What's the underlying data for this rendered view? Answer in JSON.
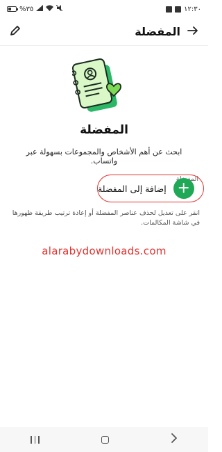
{
  "status_bar": {
    "time": "١٢:٣٠",
    "battery_text": "%٣٥",
    "battery_level": 0.35
  },
  "header": {
    "title": "المفضلة",
    "back_icon": "arrow-right-icon",
    "edit_icon": "pencil-icon"
  },
  "main": {
    "title": "المفضلة",
    "description": "ابحث عن أهم الأشخاص والمجموعات بسهولة عبر واتساب.",
    "section_label": "المفضلة",
    "add_button_label": "إضافة إلى المفضلة",
    "hint": "انقر على تعديل لحذف عناصر المفضلة أو إعادة ترتيب طريقة ظهورها في شاشة المكالمات."
  },
  "watermark": "alarabydownloads.com",
  "colors": {
    "accent_green": "#1fa855",
    "highlight_red": "#e0332f"
  },
  "navigation": {
    "recent_icon": "recent-apps-icon",
    "home_icon": "home-icon",
    "back_icon": "back-chevron-icon"
  }
}
